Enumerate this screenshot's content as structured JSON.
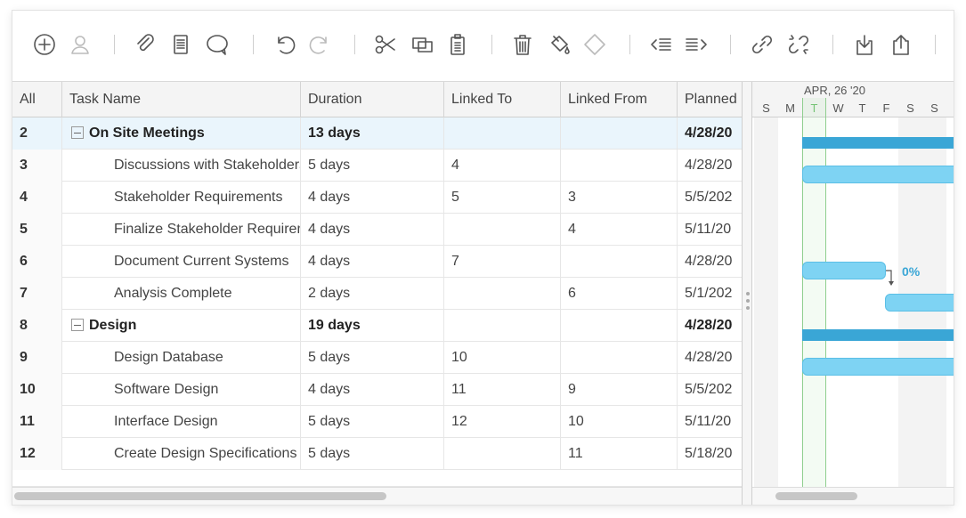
{
  "grid": {
    "columns": [
      "All",
      "Task Name",
      "Duration",
      "Linked To",
      "Linked From",
      "Planned"
    ],
    "rows": [
      {
        "id": "2",
        "name": "On Site Meetings",
        "duration": "13 days",
        "linked_to": "",
        "linked_from": "",
        "planned": "4/28/20"
      },
      {
        "id": "3",
        "name": "Discussions with Stakeholders",
        "duration": "5 days",
        "linked_to": "4",
        "linked_from": "",
        "planned": "4/28/20"
      },
      {
        "id": "4",
        "name": "Stakeholder Requirements",
        "duration": "4 days",
        "linked_to": "5",
        "linked_from": "3",
        "planned": "5/5/202"
      },
      {
        "id": "5",
        "name": "Finalize Stakeholder Requirements",
        "duration": "4 days",
        "linked_to": "",
        "linked_from": "4",
        "planned": "5/11/20"
      },
      {
        "id": "6",
        "name": "Document Current Systems",
        "duration": "4 days",
        "linked_to": "7",
        "linked_from": "",
        "planned": "4/28/20"
      },
      {
        "id": "7",
        "name": "Analysis Complete",
        "duration": "2 days",
        "linked_to": "",
        "linked_from": "6",
        "planned": "5/1/202"
      },
      {
        "id": "8",
        "name": "Design",
        "duration": "19 days",
        "linked_to": "",
        "linked_from": "",
        "planned": "4/28/20"
      },
      {
        "id": "9",
        "name": "Design Database",
        "duration": "5 days",
        "linked_to": "10",
        "linked_from": "",
        "planned": "4/28/20"
      },
      {
        "id": "10",
        "name": "Software Design",
        "duration": "4 days",
        "linked_to": "11",
        "linked_from": "9",
        "planned": "5/5/202"
      },
      {
        "id": "11",
        "name": "Interface Design",
        "duration": "5 days",
        "linked_to": "12",
        "linked_from": "10",
        "planned": "5/11/20"
      },
      {
        "id": "12",
        "name": "Create Design Specifications",
        "duration": "5 days",
        "linked_to": "",
        "linked_from": "11",
        "planned": "5/18/20"
      }
    ]
  },
  "gantt": {
    "week_label": "APR, 26 '20",
    "days": [
      "S",
      "M",
      "T",
      "W",
      "T",
      "F",
      "S",
      "S"
    ],
    "progress_label": "0%"
  },
  "toolbar": {
    "icons": [
      "add-icon",
      "user-icon",
      "attachment-icon",
      "notes-icon",
      "comment-icon",
      "undo-icon",
      "redo-icon",
      "cut-icon",
      "copy-icon",
      "paste-icon",
      "delete-icon",
      "fill-color-icon",
      "clear-format-icon",
      "outdent-icon",
      "indent-icon",
      "link-icon",
      "unlink-icon",
      "import-icon",
      "export-icon"
    ]
  },
  "colors": {
    "accent": "#3aa6d6",
    "bar": "#7ed3f3",
    "today": "#8fcf8f",
    "selected_row": "#eaf5fc"
  }
}
